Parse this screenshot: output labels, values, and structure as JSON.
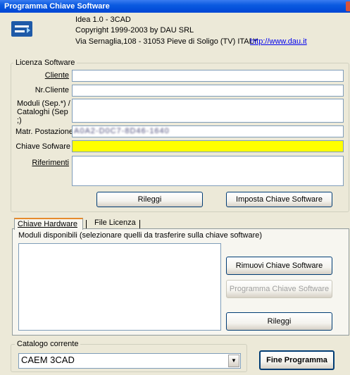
{
  "window": {
    "title": "Programma Chiave Software"
  },
  "header": {
    "product": "Idea 1.0 - 3CAD",
    "copyright": "Copyright 1999-2003 by DAU SRL",
    "address": "Via Sernaglia,108 - 31053 Pieve di Soligo (TV) ITALY",
    "url": "http://www.dau.it"
  },
  "license": {
    "group_title": "Licenza Software",
    "cliente_label": "Cliente",
    "cliente_value": "",
    "nr_cliente_label": "Nr.Cliente",
    "nr_cliente_value": "",
    "moduli_label": "Moduli (Sep.*) / Cataloghi (Sep ;)",
    "moduli_value": "",
    "matr_label": "Matr. Postazione",
    "matr_value": "A0A2-D0C7-8D46-1640",
    "chiave_label": "Chiave Sofware",
    "chiave_value": "",
    "riferimenti_label": "Riferimenti",
    "riferimenti_value": "",
    "rileggi_button": "Rileggi",
    "imposta_button": "Imposta Chiave Software"
  },
  "tabs": [
    {
      "label": "Chiave Hardware",
      "active": true
    },
    {
      "label": "File Licenza",
      "active": false
    }
  ],
  "hardware": {
    "moduli_caption": "Moduli disponibili (selezionare quelli da trasferire sulla chiave software)",
    "rimuovi_button": "Rimuovi Chiave Software",
    "programma_button": "Programma Chiave Software",
    "rileggi_button": "Rileggi"
  },
  "catalogo": {
    "group_title": "Catalogo corrente",
    "selected": "CAEM 3CAD"
  },
  "fine_button": "Fine Programma",
  "colors": {
    "titlebar": "#0a5ae0",
    "dialog_bg": "#ece9d8",
    "highlight_field": "#ffff00",
    "tab_accent": "#e68b2c"
  }
}
